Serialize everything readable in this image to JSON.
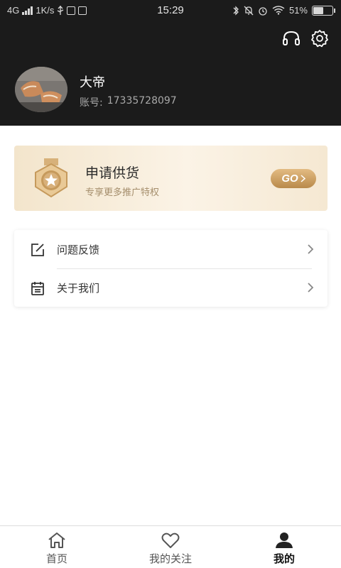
{
  "status_bar": {
    "network": "4G",
    "speed": "1K/s",
    "time": "15:29",
    "battery_percent": "51%",
    "battery_level": 0.51
  },
  "profile": {
    "name": "大帝",
    "account_label": "账号:",
    "account_value": "17335728097"
  },
  "promo": {
    "title": "申请供货",
    "subtitle": "专享更多推广特权",
    "button": "GO"
  },
  "menu": {
    "items": [
      {
        "label": "问题反馈",
        "icon": "edit-icon"
      },
      {
        "label": "关于我们",
        "icon": "calendar-icon"
      }
    ]
  },
  "bottom_nav": {
    "items": [
      {
        "label": "首页",
        "icon": "home-icon",
        "active": false
      },
      {
        "label": "我的关注",
        "icon": "heart-icon",
        "active": false
      },
      {
        "label": "我的",
        "icon": "user-icon",
        "active": true
      }
    ]
  },
  "colors": {
    "header_bg": "#1b1b1b",
    "accent_gold": "#c9a063",
    "promo_bg": "#f8ecda"
  }
}
